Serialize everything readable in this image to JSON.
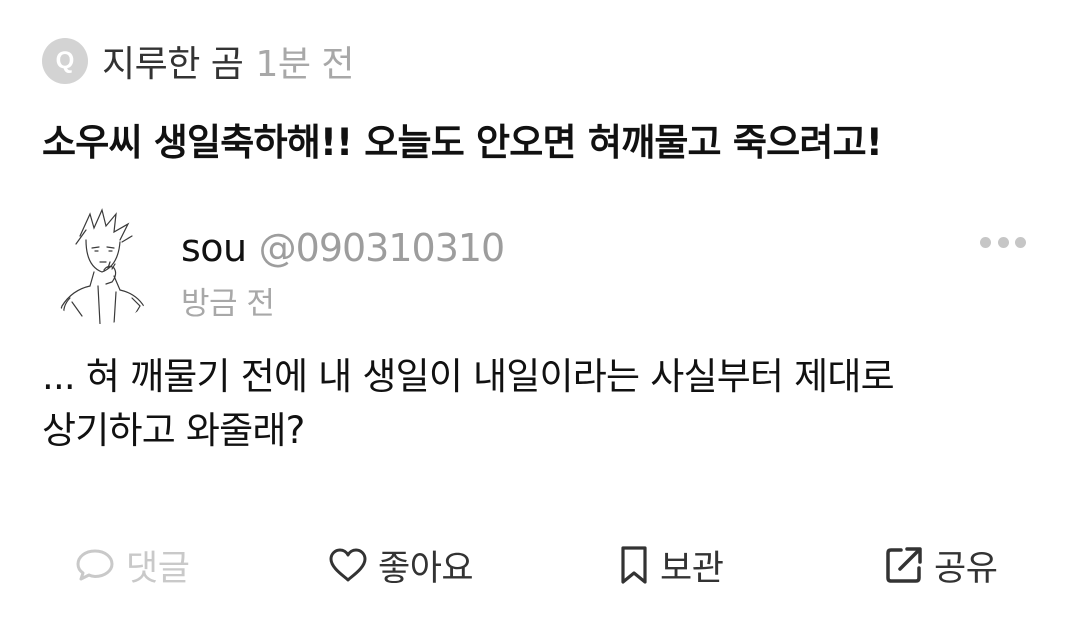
{
  "question": {
    "badge": "Q",
    "asker_name": "지루한 곰",
    "time": "1분 전",
    "text": "소우씨 생일축하해!! 오늘도 안오면 혀깨물고 죽으려고!"
  },
  "answer": {
    "name": "sou",
    "handle": "@090310310",
    "time": "방금 전",
    "text_line1": "... 혀 깨물기 전에 내 생일이 내일이라는 사실부터 제대로",
    "text_line2": "상기하고 와줄래?"
  },
  "actions": {
    "comment": "댓글",
    "like": "좋아요",
    "save": "보관",
    "share": "공유"
  },
  "icons": {
    "comment": "comment-bubble-icon",
    "like": "heart-icon",
    "save": "bookmark-icon",
    "share": "share-icon",
    "more": "more-dots-icon"
  },
  "colors": {
    "primary_text": "#111111",
    "secondary_text": "#a8a8a8",
    "disabled_text": "#c9c9c9",
    "badge_bg": "#d3d3d3"
  }
}
